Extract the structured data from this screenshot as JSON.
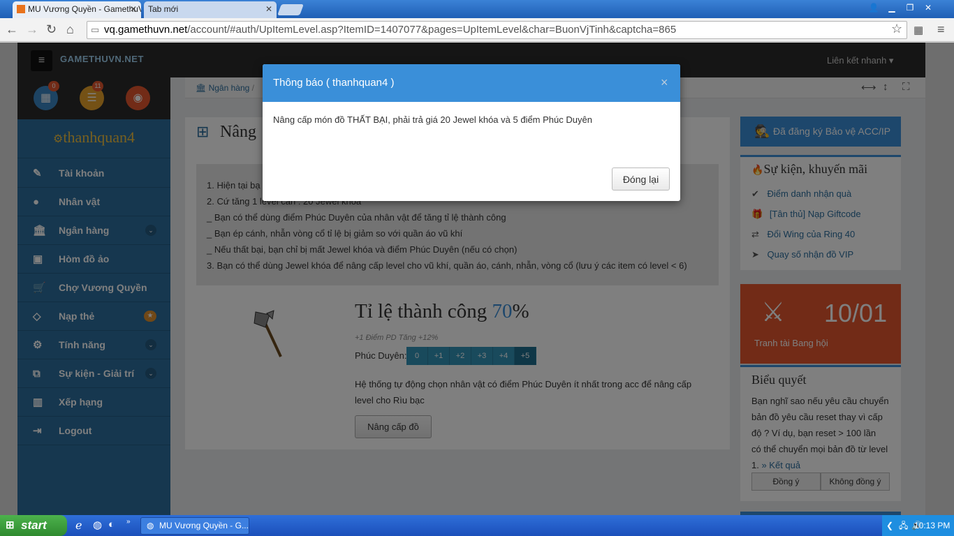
{
  "browser": {
    "tabs": [
      {
        "label": "MU Vương Quyền - GamethuV"
      },
      {
        "label": "Tab mới"
      }
    ],
    "url_host": "vq.gamethuvn.net",
    "url_path": "/account/#auth/UpItemLevel.asp?ItemID=1407077&pages=UpItemLevel&char=BuonVjTinh&captcha=865"
  },
  "topnav": {
    "logo": "GAMETHUVN.NET",
    "quick_link": "Liên kết nhanh"
  },
  "sidebar": {
    "badges": {
      "calendar": "0",
      "list": "11"
    },
    "username": "thanhquan4",
    "items": [
      {
        "label": "Tài khoản"
      },
      {
        "label": "Nhân vật"
      },
      {
        "label": "Ngân hàng"
      },
      {
        "label": "Hòm đồ ảo"
      },
      {
        "label": "Chợ Vương Quyền"
      },
      {
        "label": "Nạp thẻ"
      },
      {
        "label": "Tính năng"
      },
      {
        "label": "Sự kiện - Giải trí"
      },
      {
        "label": "Xếp hạng"
      },
      {
        "label": "Logout"
      }
    ]
  },
  "breadcrumb": {
    "bank": "Ngân hàng"
  },
  "main": {
    "title": "Nâng",
    "notes": [
      "1. Hiện tại bạ",
      "2. Cứ tăng 1 level cần : 20 Jewel khóa",
      "_ Bạn có thể dùng điểm Phúc Duyên của nhân vật để tăng tỉ lệ thành công",
      "_ Bạn ép cánh, nhẫn vòng cổ tỉ lệ bị giảm so với quần áo vũ khí",
      "_ Nếu thất bại, bạn chỉ bị mất Jewel khóa và điểm Phúc Duyên (nếu có chọn)",
      "3. Bạn có thể dùng Jewel khóa để nâng cấp level cho vũ khí, quần áo, cánh, nhẫn, vòng cổ (lưu ý các item có level < 6)"
    ],
    "success_label": "Tỉ lệ thành công ",
    "success_value": "70",
    "success_suffix": "%",
    "pd_hint": "+1 Điểm PD Tăng +12%",
    "pd_label": "Phúc Duyên:",
    "pd_options": [
      "0",
      "+1",
      "+2",
      "+3",
      "+4",
      "+5"
    ],
    "auto_text_1": "Hệ thống tự động chọn nhân vật có điểm Phúc Duyên ít nhất trong acc để nâng cấp",
    "auto_text_2": "level cho Rìu bạc",
    "upgrade_button": "Nâng cấp đồ"
  },
  "right": {
    "protect": "Đã đăng ký Bảo vệ ACC/IP",
    "events_title": "Sự kiện, khuyến mãi",
    "events": [
      "Điểm danh nhận quà",
      "[Tân thủ] Nạp Giftcode",
      "Đổi Wing của Ring 40",
      "Quay số nhận đồ VIP"
    ],
    "banner_date": "10/01",
    "banner_text": "Tranh tài Bang hội",
    "poll_title": "Biểu quyết",
    "poll_lines": [
      "Bạn nghĩ sao nếu yêu cầu chuyển",
      "bản đồ yêu cầu reset thay vì cấp",
      "độ ? Ví dụ, bạn reset > 100 lần",
      "có thể chuyển mọi bản đồ từ level"
    ],
    "poll_last": "1.",
    "poll_result": "» Kết quả",
    "poll_yes": "Đồng ý",
    "poll_no": "Không đồng ý"
  },
  "modal": {
    "title": "Thông báo ( thanhquan4 )",
    "message": "Nâng cấp món đồ THẤT BẠI, phải trả giá 20 Jewel khóa và 5 điểm Phúc Duyên",
    "close_button": "Đóng lại"
  },
  "taskbar": {
    "start": "start",
    "window": "MU Vương Quyền - G...",
    "clock": "10:13 PM"
  }
}
